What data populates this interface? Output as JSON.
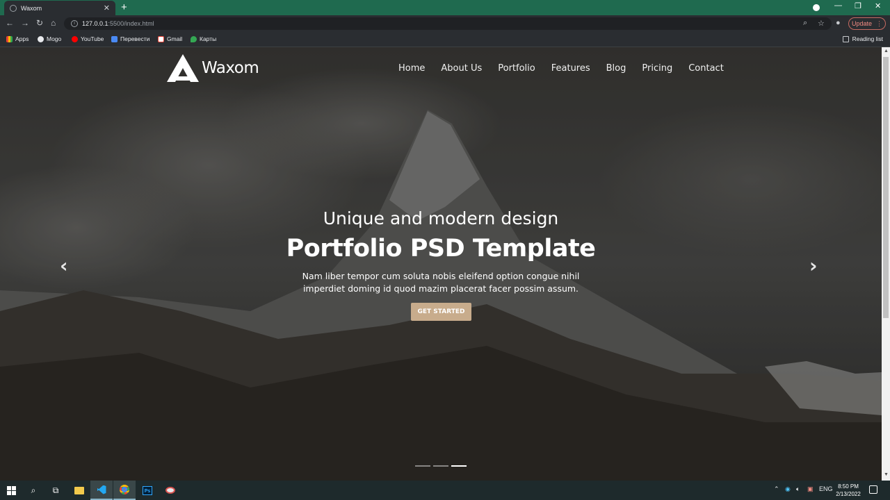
{
  "browser": {
    "tab_title": "Waxom",
    "new_tab": "+",
    "url_host": "127.0.0.1",
    "url_path": ":5500/index.html",
    "update_label": "Update",
    "bookmarks": [
      "Apps",
      "Mogo",
      "YouTube",
      "Перевести",
      "Gmail",
      "Карты"
    ],
    "reading_list": "Reading list"
  },
  "site": {
    "logo_text": "Waxom",
    "nav": [
      "Home",
      "About Us",
      "Portfolio",
      "Features",
      "Blog",
      "Pricing",
      "Contact"
    ]
  },
  "hero": {
    "subtitle": "Unique and modern design",
    "headline": "Portfolio PSD Template",
    "desc_line1": "Nam liber tempor cum soluta nobis eleifend option congue nihil",
    "desc_line2": "imperdiet doming id quod mazim placerat facer possim assum.",
    "cta": "GET STARTED",
    "slides_total": 3,
    "slide_active": 3
  },
  "taskbar": {
    "lang": "ENG",
    "time": "8:50 PM",
    "date": "2/13/2022"
  }
}
